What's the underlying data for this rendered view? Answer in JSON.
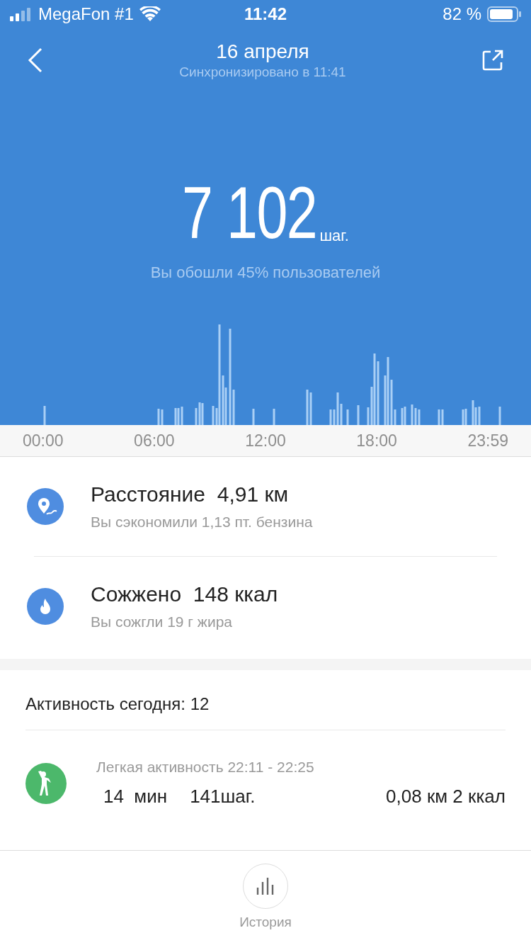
{
  "status_bar": {
    "carrier": "MegaFon #1",
    "time": "11:42",
    "battery": "82 %"
  },
  "header": {
    "title": "16 апреля",
    "subtitle": "Синхронизировано в 11:41"
  },
  "steps": {
    "value": "7 102",
    "unit": "шаг.",
    "caption": "Вы обошли 45% пользователей"
  },
  "chart": {
    "kind": "picture",
    "time_labels": [
      "00:00",
      "06:00",
      "12:00",
      "18:00",
      "23:59"
    ]
  },
  "stats": [
    {
      "kind": "distance",
      "title": "Расстояние",
      "value": "4,91 км",
      "note": "Вы сэкономили 1,13 пт. бензина"
    },
    {
      "kind": "calories",
      "title": "Сожжено",
      "value": "148 ккал",
      "note": "Вы сожгли 19 г жира"
    }
  ],
  "activity": {
    "heading": "Активность сегодня: 12",
    "items": [
      {
        "kind": "light",
        "title": "Легкая активность 22:11 - 22:25",
        "duration": "14  мин",
        "steps": "141",
        "steps_unit": "шаг.",
        "distance_calories": "0,08 км 2 ккал"
      }
    ]
  },
  "bottom_nav": {
    "label": "История"
  }
}
